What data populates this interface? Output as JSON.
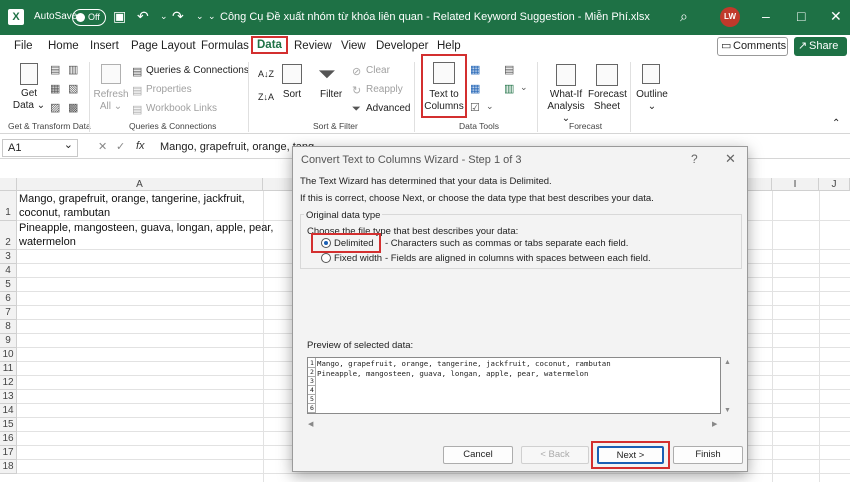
{
  "titlebar": {
    "autosave_label": "AutoSave",
    "toggle_state": "Off",
    "document_title": "Công Cụ Đề xuất nhóm từ khóa liên quan - Related Keyword Suggestion - Miễn Phí.xlsx",
    "user_initials": "LW",
    "icons": [
      "save-icon",
      "undo-icon",
      "redo-icon",
      "search-icon",
      "minimize-icon",
      "restore-icon",
      "close-icon"
    ]
  },
  "tabs": [
    {
      "label": "File"
    },
    {
      "label": "Home"
    },
    {
      "label": "Insert"
    },
    {
      "label": "Page Layout"
    },
    {
      "label": "Formulas"
    },
    {
      "label": "Data",
      "active": true
    },
    {
      "label": "Review"
    },
    {
      "label": "View"
    },
    {
      "label": "Developer"
    },
    {
      "label": "Help"
    }
  ],
  "header_buttons": {
    "comments": "Comments",
    "share": "Share"
  },
  "ribbon": {
    "get_data": {
      "line1": "Get",
      "line2": "Data"
    },
    "refresh_all": {
      "line1": "Refresh",
      "line2": "All"
    },
    "queries": {
      "connections": "Queries & Connections",
      "properties": "Properties",
      "workbook_links": "Workbook Links"
    },
    "sort_label": "Sort",
    "filter_label": "Filter",
    "clear_label": "Clear",
    "reapply_label": "Reapply",
    "advanced_label": "Advanced",
    "text_to_columns": {
      "line1": "Text to",
      "line2": "Columns"
    },
    "what_if": {
      "line1": "What-If",
      "line2": "Analysis"
    },
    "forecast_sheet": {
      "line1": "Forecast",
      "line2": "Sheet"
    },
    "outline_label": "Outline",
    "groups": {
      "get_transform": "Get & Transform Data",
      "queries_connections": "Queries & Connections",
      "sort_filter": "Sort & Filter",
      "data_tools": "Data Tools",
      "forecast": "Forecast"
    }
  },
  "formula_bar": {
    "name_box": "A1",
    "fx": "fx",
    "formula": "Mango, grapefruit, orange, tang"
  },
  "sheet": {
    "column_headers": [
      "A",
      "I",
      "J"
    ],
    "row_numbers": [
      "1",
      "2",
      "3",
      "4",
      "5",
      "6",
      "7",
      "8",
      "9",
      "10",
      "11",
      "12",
      "13",
      "14",
      "15",
      "16",
      "17",
      "18"
    ],
    "cells": {
      "a1_line1": "Mango, grapefruit, orange, tangerine, jackfruit,",
      "a1_line2": "coconut, rambutan",
      "a2_line1": "Pineapple, mangosteen, guava, longan, apple, pear,",
      "a2_line2": "watermelon"
    }
  },
  "dialog": {
    "title": "Convert Text to Columns Wizard - Step 1 of 3",
    "help": "?",
    "close": "✕",
    "intro1": "The Text Wizard has determined that your data is Delimited.",
    "intro2": "If this is correct, choose Next, or choose the data type that best describes your data.",
    "original_data_type": "Original data type",
    "choose_prompt": "Choose the file type that best describes your data:",
    "options": [
      {
        "label": "Delimited",
        "desc": "- Characters such as commas or tabs separate each field.",
        "selected": true
      },
      {
        "label": "Fixed width",
        "desc": "- Fields are aligned in columns with spaces between each field.",
        "selected": false
      }
    ],
    "preview_label": "Preview of selected data:",
    "preview_lines": [
      {
        "num": "1",
        "text": "Mango, grapefruit, orange, tangerine, jackfruit, coconut, rambutan"
      },
      {
        "num": "2",
        "text": "Pineapple, mangosteen, guava, longan, apple, pear, watermelon"
      },
      {
        "num": "3",
        "text": ""
      },
      {
        "num": "4",
        "text": ""
      },
      {
        "num": "5",
        "text": ""
      },
      {
        "num": "6",
        "text": ""
      }
    ],
    "buttons": {
      "cancel": "Cancel",
      "back": "< Back",
      "next": "Next >",
      "finish": "Finish"
    }
  },
  "colors": {
    "excel_green": "#1e7145",
    "highlight_red": "#d32f2f",
    "accent_blue": "#1a5fb4"
  }
}
